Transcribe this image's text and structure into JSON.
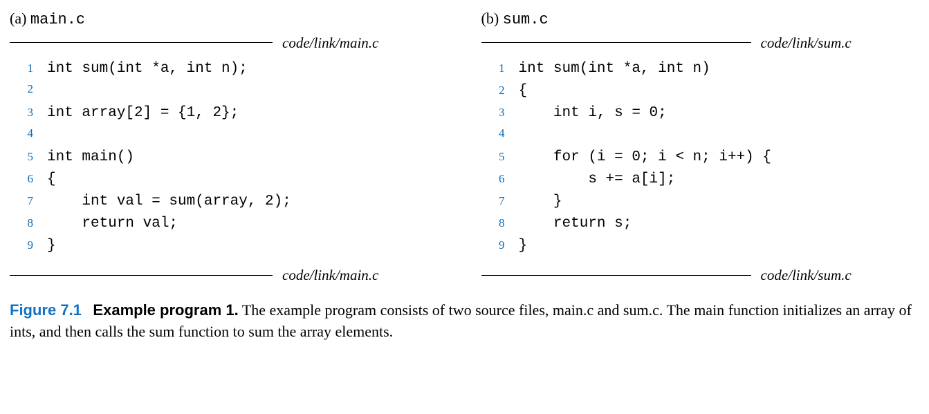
{
  "panels": {
    "a": {
      "tag": "(a)",
      "filename": "main.c",
      "path": "code/link/main.c",
      "lines": [
        "int sum(int *a, int n);",
        "",
        "int array[2] = {1, 2};",
        "",
        "int main()",
        "{",
        "    int val = sum(array, 2);",
        "    return val;",
        "}"
      ]
    },
    "b": {
      "tag": "(b)",
      "filename": "sum.c",
      "path": "code/link/sum.c",
      "lines": [
        "int sum(int *a, int n)",
        "{",
        "    int i, s = 0;",
        "",
        "    for (i = 0; i < n; i++) {",
        "        s += a[i];",
        "    }",
        "    return s;",
        "}"
      ]
    }
  },
  "caption": {
    "figure": "Figure 7.1",
    "title": "Example program 1.",
    "text_1": " The example program consists of two source files, ",
    "file_1": "main.c",
    "text_2": " and ",
    "file_2": "sum.c",
    "text_3": ". The ",
    "fn_1": "main",
    "text_4": " function initializes an array of ",
    "type_1": "ints",
    "text_5": ", and then calls the ",
    "fn_2": "sum",
    "text_6": " function to sum the array elements."
  }
}
